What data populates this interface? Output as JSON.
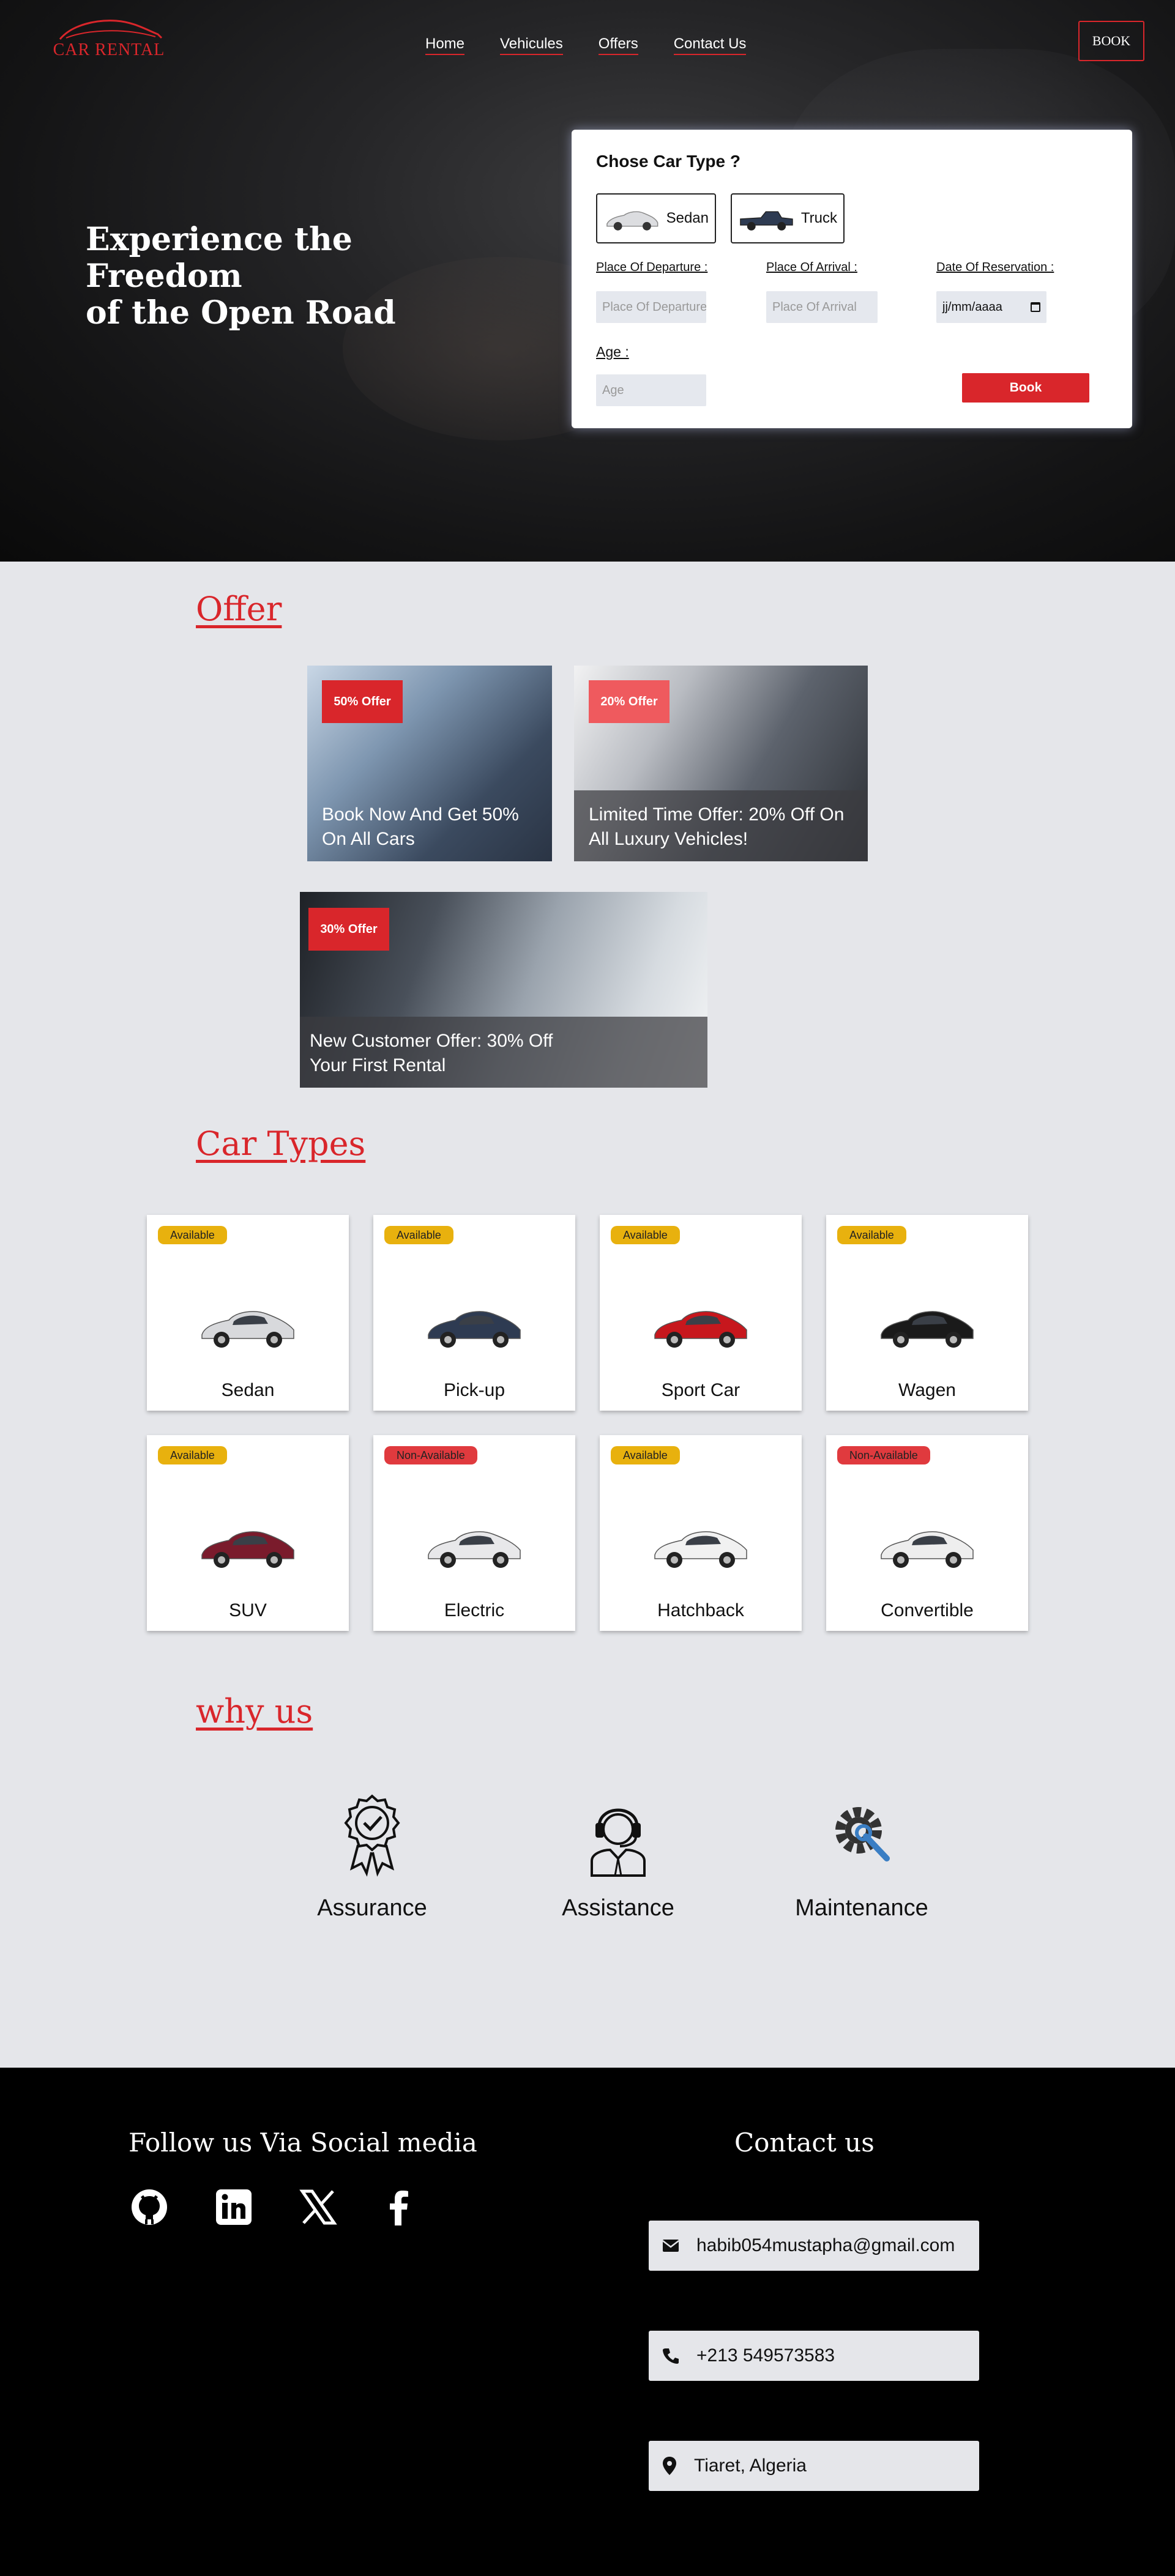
{
  "header": {
    "logo_text": "CAR RENTAL",
    "nav": [
      "Home",
      "Vehicules",
      "Offers",
      "Contact Us"
    ],
    "book_label": "BOOK"
  },
  "hero": {
    "title_lines": [
      "Experience the",
      "Freedom",
      "of the Open Road"
    ]
  },
  "booking": {
    "title": "Chose Car Type ?",
    "types": [
      "Sedan",
      "Truck"
    ],
    "departure_label": "Place Of Departure :",
    "departure_placeholder": "Place Of Departure",
    "arrival_label": "Place Of Arrival :",
    "arrival_placeholder": "Place Of Arrival",
    "date_label": "Date Of Reservation :",
    "date_value": "jj/mm/aaaa",
    "age_label": "Age :",
    "age_placeholder": "Age",
    "book_button": "Book"
  },
  "offers": {
    "title": "Offer",
    "items": [
      {
        "badge": "50% Offer",
        "text": "Book Now And Get 50% On All Cars",
        "badge_color": "#d9262b"
      },
      {
        "badge": "20% Offer",
        "text": "Limited Time Offer: 20% Off On All Luxury Vehicles!",
        "badge_color": "#ef5a5e"
      },
      {
        "badge": "30% Offer",
        "text": "New Customer Offer: 30% Off Your First Rental",
        "badge_color": "#d9262b"
      }
    ]
  },
  "car_types": {
    "title": "Car Types",
    "items": [
      {
        "name": "Sedan",
        "status": "Available",
        "color": "#d8d9dc"
      },
      {
        "name": "Pick-up",
        "status": "Available",
        "color": "#2e3b52"
      },
      {
        "name": "Sport Car",
        "status": "Available",
        "color": "#c7171d"
      },
      {
        "name": "Wagen",
        "status": "Available",
        "color": "#1a1a1a"
      },
      {
        "name": "SUV",
        "status": "Available",
        "color": "#7a1b2c"
      },
      {
        "name": "Electric",
        "status": "Non-Available",
        "color": "#e8e8ea"
      },
      {
        "name": "Hatchback",
        "status": "Available",
        "color": "#f1f1f1"
      },
      {
        "name": "Convertible",
        "status": "Non-Available",
        "color": "#eeeeee"
      }
    ]
  },
  "why_us": {
    "title": "why us",
    "items": [
      "Assurance",
      "Assistance",
      "Maintenance"
    ]
  },
  "footer": {
    "social_title": "Follow us Via Social media",
    "social_icons": [
      "github-icon",
      "linkedin-icon",
      "x-icon",
      "facebook-icon"
    ],
    "contact_title": "Contact us",
    "email": "habib054mustapha@gmail.com",
    "phone": "+213 549573583",
    "location": "Tiaret, Algeria"
  },
  "colors": {
    "accent": "#d9262b",
    "available": "#e8b10e",
    "non_available": "#e03a3e",
    "page_bg": "#e5e6ea"
  }
}
